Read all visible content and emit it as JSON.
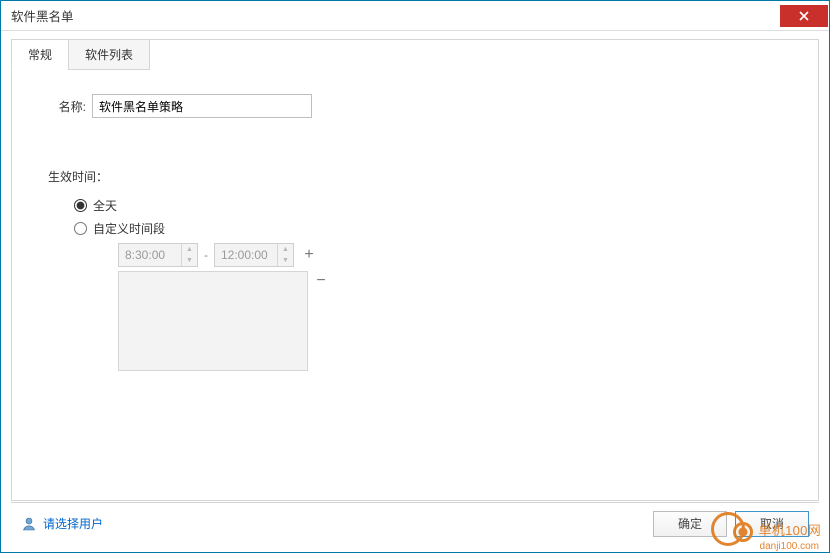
{
  "window": {
    "title": "软件黑名单"
  },
  "tabs": {
    "general": "常规",
    "softwareList": "软件列表"
  },
  "form": {
    "nameLabel": "名称:",
    "nameValue": "软件黑名单策略",
    "effectiveLabel": "生效时间：",
    "radioAllDay": "全天",
    "radioCustom": "自定义时间段",
    "timeFrom": "8:30:00",
    "timeTo": "12:00:00",
    "dash": "-",
    "plus": "+",
    "minus": "−"
  },
  "footer": {
    "selectUser": "请选择用户",
    "ok": "确定",
    "cancel": "取消"
  },
  "watermark": {
    "brand": "单机100网",
    "url": "danji100.com"
  }
}
